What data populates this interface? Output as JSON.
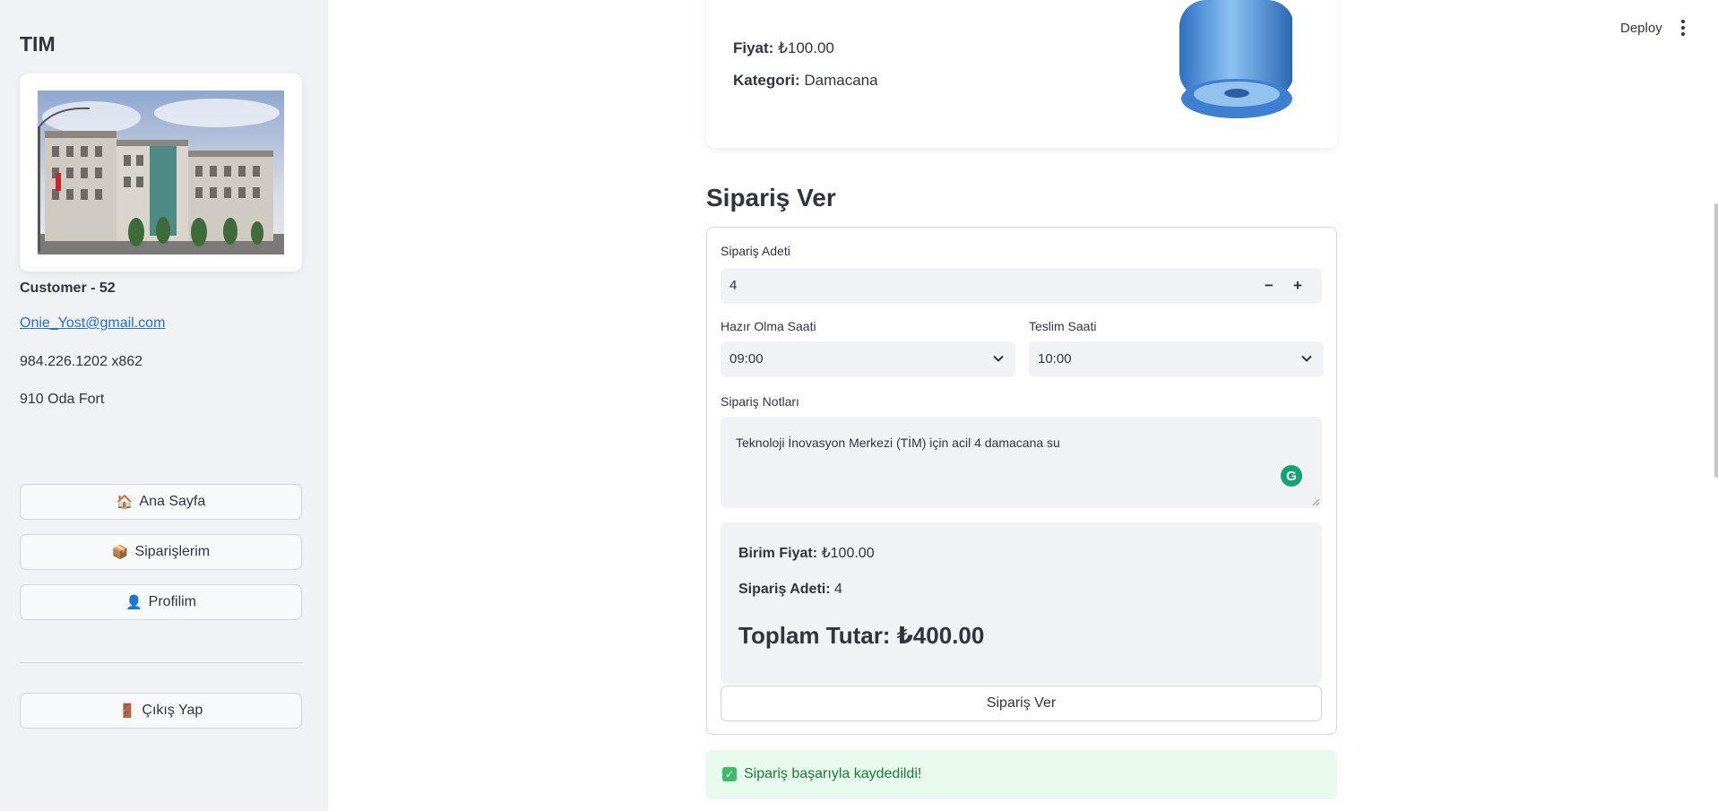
{
  "header": {
    "deploy_label": "Deploy",
    "menu_icon": "kebab-menu-icon"
  },
  "sidebar": {
    "brand": "TIM",
    "customer": {
      "name": "Customer - 52",
      "email": "Onie_Yost@gmail.com",
      "phone": "984.226.1202 x862",
      "address": "910 Oda Fort"
    },
    "nav": [
      {
        "icon": "🏠",
        "label": "Ana Sayfa"
      },
      {
        "icon": "📦",
        "label": "Siparişlerim"
      },
      {
        "icon": "👤",
        "label": "Profilim"
      }
    ],
    "logout": {
      "icon": "🚪",
      "label": "Çıkış Yap"
    }
  },
  "product": {
    "price_label": "Fiyat:",
    "price_value": "₺100.00",
    "category_label": "Kategori:",
    "category_value": "Damacana"
  },
  "order_form": {
    "title": "Sipariş Ver",
    "quantity_label": "Sipariş Adeti",
    "quantity_value": "4",
    "ready_time_label": "Hazır Olma Saati",
    "ready_time_value": "09:00",
    "delivery_time_label": "Teslim Saati",
    "delivery_time_value": "10:00",
    "notes_label": "Sipariş Notları",
    "notes_value": "Teknoloji İnovasyon Merkezi (TİM) için acil 4 damacana su",
    "grammarly_letter": "G",
    "summary": {
      "unit_price_label": "Birim Fiyat:",
      "unit_price_value": "₺100.00",
      "quantity_label": "Sipariş Adeti:",
      "quantity_value": "4",
      "total_label": "Toplam Tutar:",
      "total_value": "₺400.00"
    },
    "submit_label": "Sipariş Ver"
  },
  "success_message": "Sipariş başarıyla kaydedildi!",
  "colors": {
    "sidebar_bg": "#f0f2f6",
    "link": "#1f6fd1",
    "success_bg": "#e8f9ee",
    "success_text": "#1b7a3d"
  }
}
